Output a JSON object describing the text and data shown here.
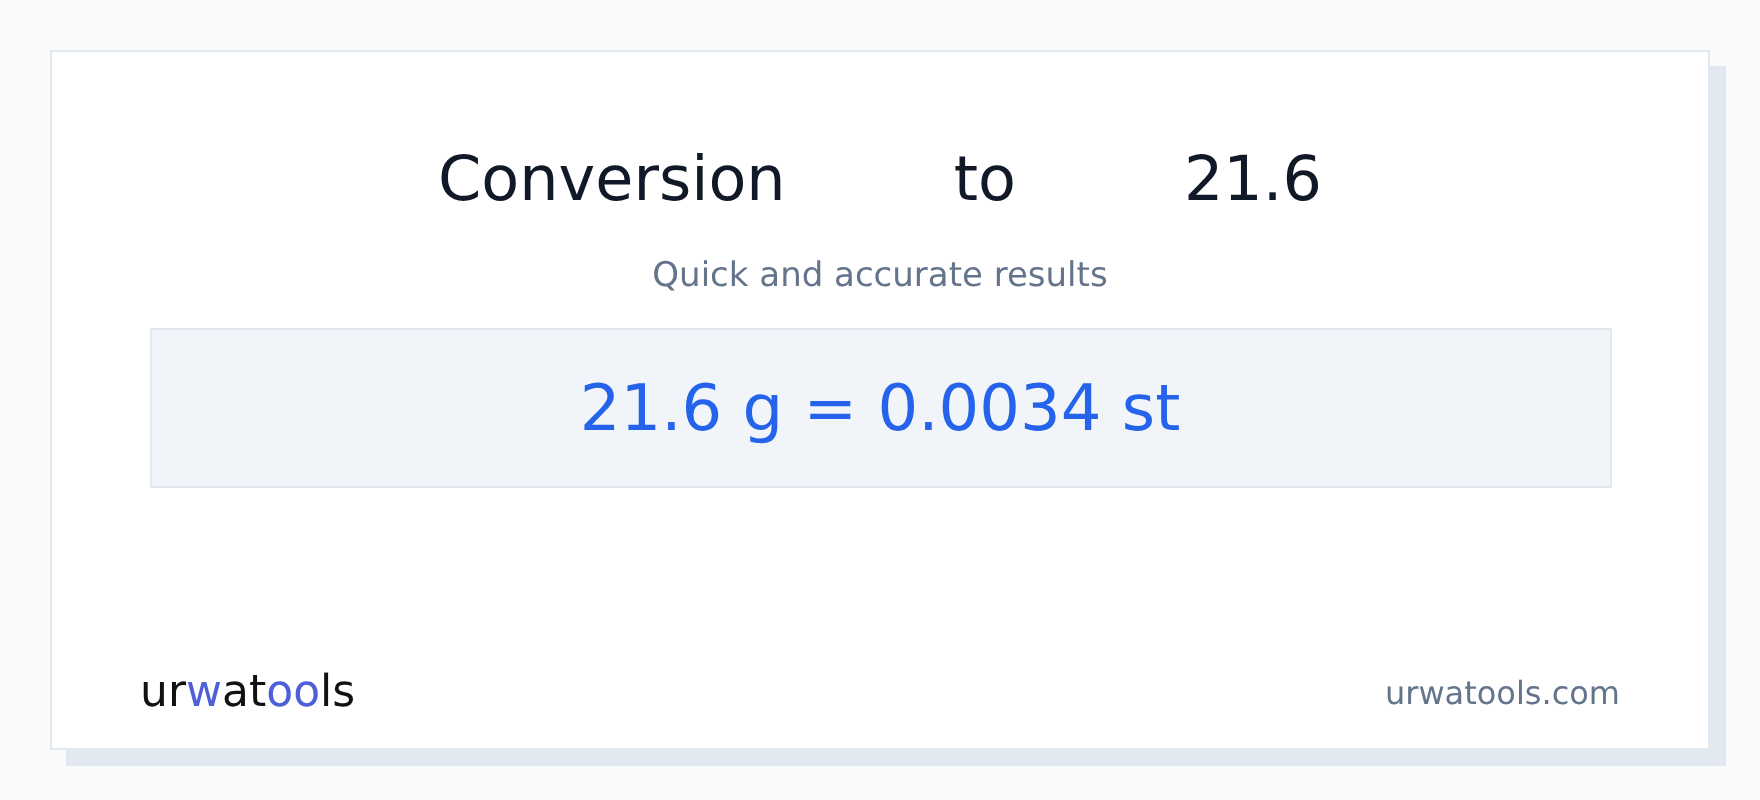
{
  "title_words": [
    "Conversion",
    "to",
    "21.6"
  ],
  "subtitle": "Quick and accurate results",
  "result": "21.6 g = 0.0034 st",
  "logo": [
    {
      "text": "ur",
      "accent": false
    },
    {
      "text": "w",
      "accent": true
    },
    {
      "text": "at",
      "accent": false
    },
    {
      "text": "oo",
      "accent": true
    },
    {
      "text": "ls",
      "accent": false
    }
  ],
  "site": "urwatools.com"
}
